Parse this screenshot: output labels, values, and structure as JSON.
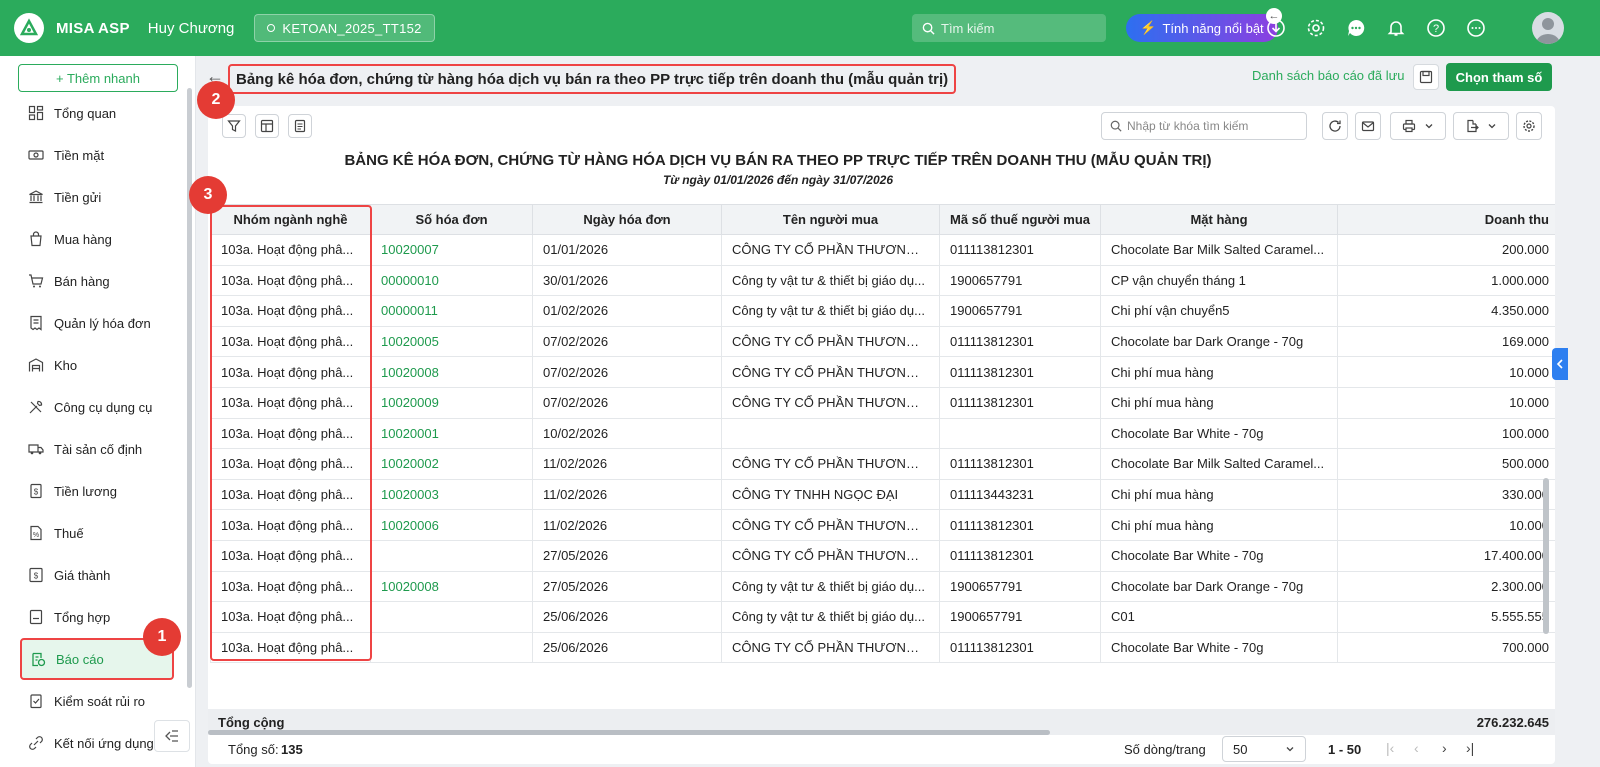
{
  "topbar": {
    "app_name": "MISA ASP",
    "company": "Huy Chương",
    "database": "KETOAN_2025_TT152",
    "search_placeholder": "Tìm kiếm",
    "feature_label": "Tính năng nổi bật"
  },
  "sidebar": {
    "quick_add": "+ Thêm nhanh",
    "items": [
      {
        "label": "Tổng quan",
        "icon": "dashboard-icon"
      },
      {
        "label": "Tiền mặt",
        "icon": "cash-icon"
      },
      {
        "label": "Tiền gửi",
        "icon": "bank-icon"
      },
      {
        "label": "Mua hàng",
        "icon": "shopping-bag-icon"
      },
      {
        "label": "Bán hàng",
        "icon": "cart-icon"
      },
      {
        "label": "Quản lý hóa đơn",
        "icon": "invoice-icon"
      },
      {
        "label": "Kho",
        "icon": "warehouse-icon"
      },
      {
        "label": "Công cụ dụng cụ",
        "icon": "tools-icon"
      },
      {
        "label": "Tài sản cố định",
        "icon": "truck-icon"
      },
      {
        "label": "Tiền lương",
        "icon": "salary-icon"
      },
      {
        "label": "Thuế",
        "icon": "tax-icon"
      },
      {
        "label": "Giá thành",
        "icon": "cost-icon"
      },
      {
        "label": "Tổng hợp",
        "icon": "ledger-icon"
      },
      {
        "label": "Báo cáo",
        "icon": "report-icon"
      },
      {
        "label": "Kiểm soát rủi ro",
        "icon": "risk-icon"
      },
      {
        "label": "Kết nối ứng dụng",
        "icon": "connect-icon"
      }
    ]
  },
  "header": {
    "title": "Bảng kê hóa đơn, chứng từ hàng hóa dịch vụ bán ra theo PP trực tiếp trên doanh thu (mẫu quản trị)",
    "saved_reports": "Danh sách báo cáo đã lưu",
    "choose_params": "Chọn tham số"
  },
  "report": {
    "search_placeholder": "Nhập từ khóa tìm kiếm",
    "title": "BẢNG KÊ HÓA ĐƠN, CHỨNG TỪ HÀNG HÓA DỊCH VỤ BÁN RA THEO PP TRỰC TIẾP TRÊN DOANH THU (MẪU QUẢN TRỊ)",
    "subtitle": "Từ ngày 01/01/2026 đến ngày 31/07/2026",
    "columns": [
      "Nhóm ngành nghề",
      "Số hóa đơn",
      "Ngày hóa đơn",
      "Tên người mua",
      "Mã số thuế người mua",
      "Mặt hàng",
      "Doanh thu"
    ],
    "rows": [
      [
        "103a. Hoạt động phâ...",
        "10020007",
        "01/01/2026",
        "CÔNG TY CỔ PHẦN THƯƠNG ...",
        "011113812301",
        "Chocolate Bar Milk Salted Caramel...",
        "200.000"
      ],
      [
        "103a. Hoạt động phâ...",
        "00000010",
        "30/01/2026",
        "Công ty vật tư & thiết bị giáo dụ...",
        "1900657791",
        "CP vận chuyển tháng 1",
        "1.000.000"
      ],
      [
        "103a. Hoạt động phâ...",
        "00000011",
        "01/02/2026",
        "Công ty vật tư & thiết bị giáo dụ...",
        "1900657791",
        "Chi phí vận chuyển5",
        "4.350.000"
      ],
      [
        "103a. Hoạt động phâ...",
        "10020005",
        "07/02/2026",
        "CÔNG TY CỔ PHẦN THƯƠNG ...",
        "011113812301",
        "Chocolate bar Dark Orange - 70g",
        "169.000"
      ],
      [
        "103a. Hoạt động phâ...",
        "10020008",
        "07/02/2026",
        "CÔNG TY CỔ PHẦN THƯƠNG ...",
        "011113812301",
        "Chi phí mua hàng",
        "10.000"
      ],
      [
        "103a. Hoạt động phâ...",
        "10020009",
        "07/02/2026",
        "CÔNG TY CỔ PHẦN THƯƠNG ...",
        "011113812301",
        "Chi phí mua hàng",
        "10.000"
      ],
      [
        "103a. Hoạt động phâ...",
        "10020001",
        "10/02/2026",
        "",
        "",
        "Chocolate Bar White - 70g",
        "100.000"
      ],
      [
        "103a. Hoạt động phâ...",
        "10020002",
        "11/02/2026",
        "CÔNG TY CỔ PHẦN THƯƠNG ...",
        "011113812301",
        "Chocolate Bar Milk Salted Caramel...",
        "500.000"
      ],
      [
        "103a. Hoạt động phâ...",
        "10020003",
        "11/02/2026",
        "CÔNG TY TNHH NGỌC ĐẠI",
        "011113443231",
        "Chi phí mua hàng",
        "330.000"
      ],
      [
        "103a. Hoạt động phâ...",
        "10020006",
        "11/02/2026",
        "CÔNG TY CỔ PHẦN THƯƠNG ...",
        "011113812301",
        "Chi phí mua hàng",
        "10.000"
      ],
      [
        "103a. Hoạt động phâ...",
        "",
        "27/05/2026",
        "CÔNG TY CỔ PHẦN THƯƠNG ...",
        "011113812301",
        "Chocolate Bar White - 70g",
        "17.400.000"
      ],
      [
        "103a. Hoạt động phâ...",
        "10020008",
        "27/05/2026",
        "Công ty vật tư & thiết bị giáo dụ...",
        "1900657791",
        "Chocolate bar Dark Orange - 70g",
        "2.300.000"
      ],
      [
        "103a. Hoạt động phâ...",
        "",
        "25/06/2026",
        "Công ty vật tư & thiết bị giáo dụ...",
        "1900657791",
        "C01",
        "5.555.555"
      ],
      [
        "103a. Hoạt động phâ...",
        "",
        "25/06/2026",
        "CÔNG TY CỔ PHẦN THƯƠNG ...",
        "011113812301",
        "Chocolate Bar White - 70g",
        "700.000"
      ]
    ],
    "total_label": "Tổng cộng",
    "total_value": "276.232.645"
  },
  "footer": {
    "total_prefix": "Tổng số:",
    "total_count": "135",
    "rows_per_page_label": "Số dòng/trang",
    "rows_per_page": "50",
    "range": "1 - 50"
  },
  "annotations": [
    "1",
    "2",
    "3"
  ],
  "colors": {
    "brand": "#2bab5c",
    "highlight": "#e44444",
    "badge": "#e43b34"
  }
}
